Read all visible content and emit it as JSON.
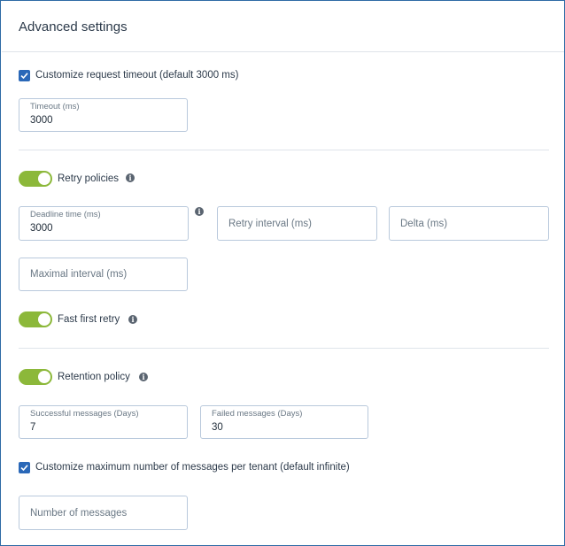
{
  "header": {
    "title": "Advanced settings"
  },
  "timeout": {
    "checkbox_label": "Customize request timeout (default 3000 ms)",
    "checked": true,
    "field_label": "Timeout (ms)",
    "field_value": "3000"
  },
  "retry": {
    "toggle_label": "Retry policies",
    "enabled": true,
    "deadline_label": "Deadline time (ms)",
    "deadline_value": "3000",
    "retry_interval_placeholder": "Retry interval (ms)",
    "delta_placeholder": "Delta (ms)",
    "maximal_interval_placeholder": "Maximal interval (ms)",
    "fast_first_retry_label": "Fast first retry",
    "fast_first_retry_enabled": true
  },
  "retention": {
    "toggle_label": "Retention policy",
    "enabled": true,
    "successful_label": "Successful messages (Days)",
    "successful_value": "7",
    "failed_label": "Failed messages (Days)",
    "failed_value": "30"
  },
  "max_messages": {
    "checkbox_label": "Customize maximum number of messages per tenant (default infinite)",
    "checked": true,
    "placeholder": "Number of messages"
  },
  "icons": {
    "info": "info-icon",
    "check": "checkmark-icon"
  },
  "colors": {
    "accent_blue": "#2a68b8",
    "toggle_green": "#8cb83a",
    "border": "#b9c9dc"
  }
}
